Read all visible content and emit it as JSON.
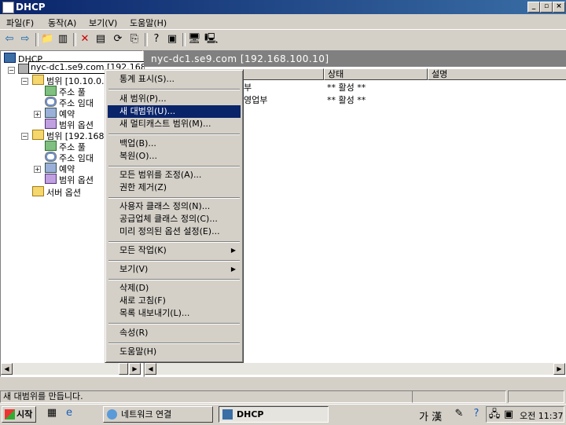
{
  "window": {
    "title": "DHCP"
  },
  "menubar": [
    "파일(F)",
    "동작(A)",
    "보기(V)",
    "도움말(H)"
  ],
  "tree": {
    "root": "DHCP",
    "server": "nyc-dc1.se9.com [192.168.100.10]",
    "scope1": "범위 [10.10.0.0]",
    "scope2": "범위 [192.168.1",
    "address_pool": "주소 풀",
    "address_lease": "주소 임대",
    "reservations": "예약",
    "scope_options": "범위 옵션",
    "server_options": "서버 옵션"
  },
  "right": {
    "header": "nyc-dc1.se9.com [192.168.100.10]",
    "columns": [
      "상태",
      "설명"
    ],
    "rows": [
      {
        "name_tail": "부",
        "status": "** 활성 **"
      },
      {
        "name_tail": "영업부",
        "status": "** 활성 **"
      }
    ]
  },
  "context_menu": {
    "items": [
      "통계 표시(S)...",
      "새 범위(P)...",
      "새 대범위(U)...",
      "새 멀티캐스트 범위(M)...",
      "백업(B)...",
      "복원(O)...",
      "모든 범위를 조정(A)...",
      "권한 제거(Z)",
      "사용자 클래스 정의(N)...",
      "공급업체 클래스 정의(C)...",
      "미리 정의된 옵션 설정(E)...",
      "모든 작업(K)",
      "보기(V)",
      "삭제(D)",
      "새로 고침(F)",
      "목록 내보내기(L)...",
      "속성(R)",
      "도움말(H)"
    ],
    "selected_index": 2
  },
  "status_bar": {
    "text": "새 대범위를 만듭니다."
  },
  "taskbar": {
    "start": "시작",
    "tasks": [
      "네트워크 연결",
      "DHCP"
    ],
    "ime": "가 漢",
    "clock": "오전 11:37"
  }
}
